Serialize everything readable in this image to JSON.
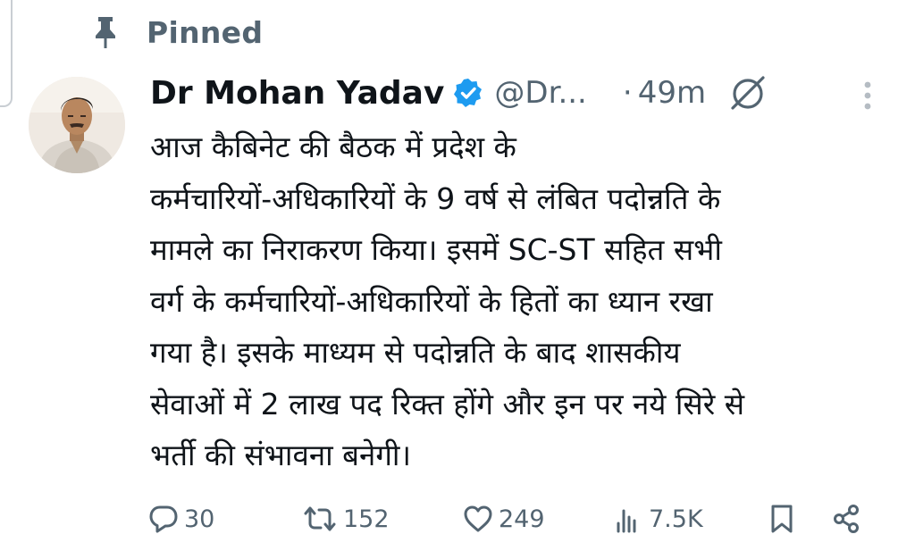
{
  "pinned": {
    "label": "Pinned"
  },
  "tweet": {
    "author": {
      "name": "Dr Mohan Yadav",
      "handle": "@Dr...",
      "verified": true
    },
    "separator": "·",
    "time": "49m",
    "lines": [
      "आज कैबिनेट की बैठक में प्रदेश के",
      "कर्मचारियों-अधिकारियों के 9 वर्ष से लंबित पदोन्नति के",
      "मामले का निराकरण किया। इसमें SC-ST सहित सभी",
      "वर्ग के कर्मचारियों-अधिकारियों के हितों का ध्यान रखा",
      "गया है। इसके माध्यम से पदोन्नति के बाद शासकीय",
      "सेवाओं में 2 लाख पद रिक्त होंगे और इन पर नये सिरे से",
      "भर्ती की संभावना बनेगी।"
    ],
    "actions": {
      "replies": "30",
      "reposts": "152",
      "likes": "249",
      "views": "7.5K"
    }
  },
  "icons": {
    "pin": "pin-icon",
    "verified": "verified-badge-icon",
    "grok": "grok-icon",
    "more": "more-vertical-icon",
    "reply": "reply-icon",
    "repost": "repost-icon",
    "like": "heart-icon",
    "views": "views-icon",
    "bookmark": "bookmark-icon",
    "share": "share-icon"
  },
  "colors": {
    "text": "#0f1419",
    "secondary": "#536471",
    "verified": "#1d9bf0"
  }
}
